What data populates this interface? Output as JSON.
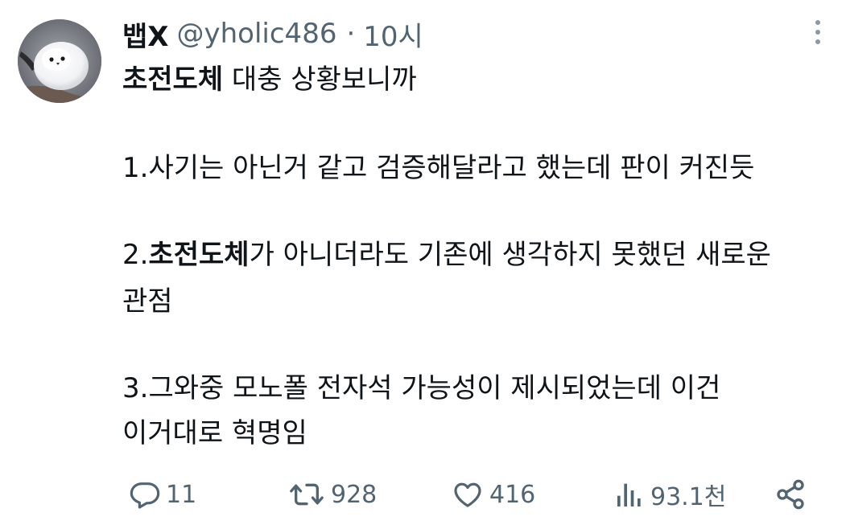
{
  "tweet": {
    "author": {
      "display_name": "뱁X",
      "handle": "@yholic486",
      "separator": "·",
      "time": "10시"
    },
    "lines": {
      "l1_hashtag": "초전도체",
      "l1_rest": " 대충 상황보니까",
      "l2": "1.사기는 아닌거 같고 검증해달라고 했는데 판이 커진듯",
      "l3_prefix": "2.",
      "l3_hashtag": "초전도체",
      "l3_rest": "가 아니더라도 기존에 생각하지 못했던 새로운",
      "l4": "관점",
      "l5": "3.그와중 모노폴 전자석 가능성이 제시되었는데 이건",
      "l6": "이거대로 혁명임"
    },
    "actions": {
      "reply_count": "11",
      "retweet_count": "928",
      "like_count": "416",
      "view_count": "93.1천"
    },
    "icons": {
      "more": "more-dots-icon",
      "reply": "reply-bubble-icon",
      "retweet": "retweet-icon",
      "like": "heart-icon",
      "views": "bar-chart-icon",
      "share": "share-icon"
    },
    "colors": {
      "text": "#0f1419",
      "secondary": "#536471"
    }
  }
}
